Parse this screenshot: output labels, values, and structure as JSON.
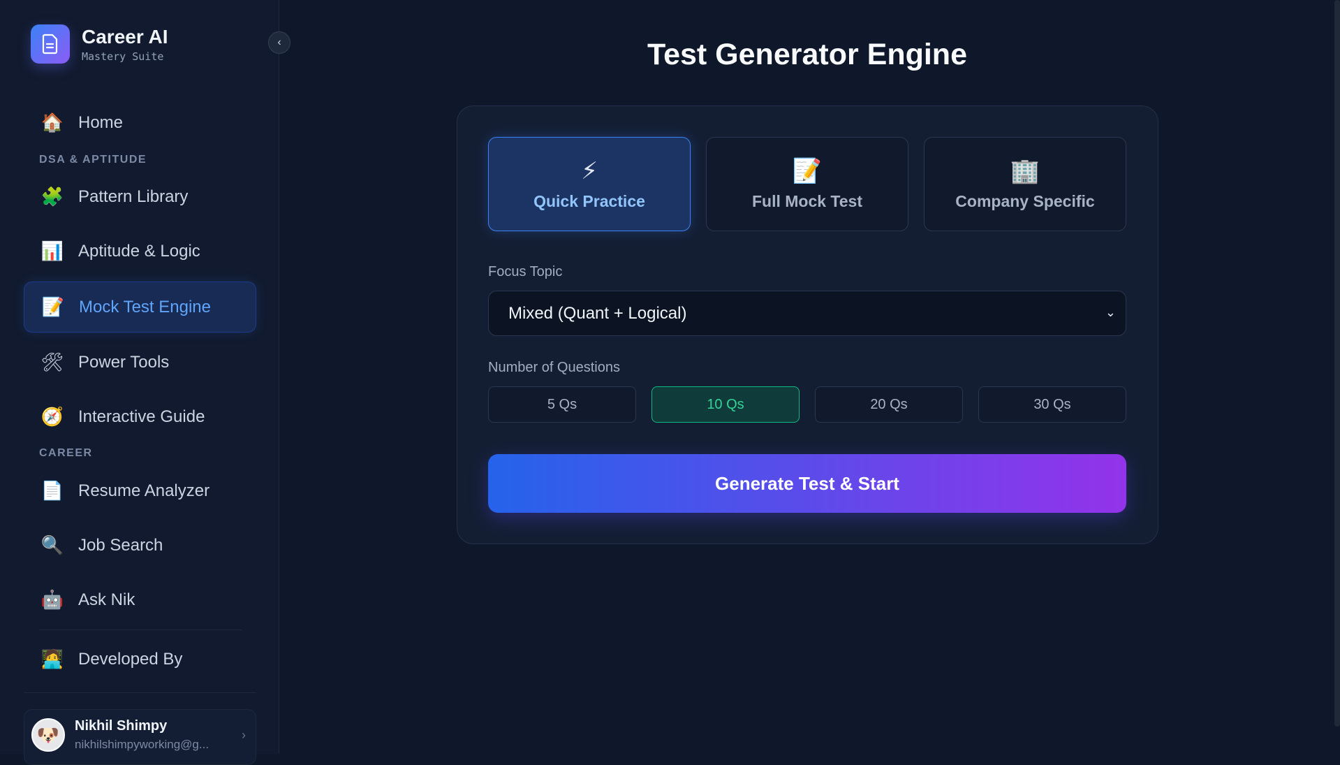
{
  "brand": {
    "title": "Career AI",
    "subtitle": "Mastery Suite"
  },
  "sidebar": {
    "items": [
      {
        "label": "Home",
        "icon": "🏠",
        "icon_name": "home-icon"
      },
      {
        "label": "Pattern Library",
        "icon": "🧩",
        "icon_name": "puzzle-icon"
      },
      {
        "label": "Aptitude & Logic",
        "icon": "📊",
        "icon_name": "bar-chart-icon"
      },
      {
        "label": "Mock Test Engine",
        "icon": "📝",
        "icon_name": "memo-icon",
        "active": true
      },
      {
        "label": "Power Tools",
        "icon": "🛠",
        "icon_name": "tools-icon"
      },
      {
        "label": "Interactive Guide",
        "icon": "🧭",
        "icon_name": "compass-icon"
      },
      {
        "label": "Resume Analyzer",
        "icon": "📄",
        "icon_name": "document-icon"
      },
      {
        "label": "Job Search",
        "icon": "🔍",
        "icon_name": "magnifier-icon"
      },
      {
        "label": "Ask Nik",
        "icon": "🤖",
        "icon_name": "robot-icon"
      },
      {
        "label": "Developed By",
        "icon": "🧑‍💻",
        "icon_name": "developer-icon"
      }
    ],
    "sections": {
      "dsa": "DSA & APTITUDE",
      "career": "CAREER"
    }
  },
  "user": {
    "name": "Nikhil Shimpy",
    "email": "nikhilshimpyworking@g...",
    "avatar_icon": "🐶"
  },
  "main": {
    "title": "Test Generator Engine",
    "modes": [
      {
        "label": "Quick Practice",
        "icon": "⚡",
        "icon_name": "lightning-icon",
        "active": true
      },
      {
        "label": "Full Mock Test",
        "icon": "📝",
        "icon_name": "memo-icon"
      },
      {
        "label": "Company Specific",
        "icon": "🏢",
        "icon_name": "building-icon"
      }
    ],
    "focus_label": "Focus Topic",
    "focus_value": "Mixed (Quant + Logical)",
    "questions_label": "Number of Questions",
    "question_options": [
      "5 Qs",
      "10 Qs",
      "20 Qs",
      "30 Qs"
    ],
    "selected_questions": "10 Qs",
    "generate_label": "Generate Test & Start"
  },
  "colors": {
    "accent": "#3b82f6",
    "success": "#34d399",
    "gradient_start": "#2563eb",
    "gradient_end": "#9333ea",
    "background": "#0f172a"
  }
}
